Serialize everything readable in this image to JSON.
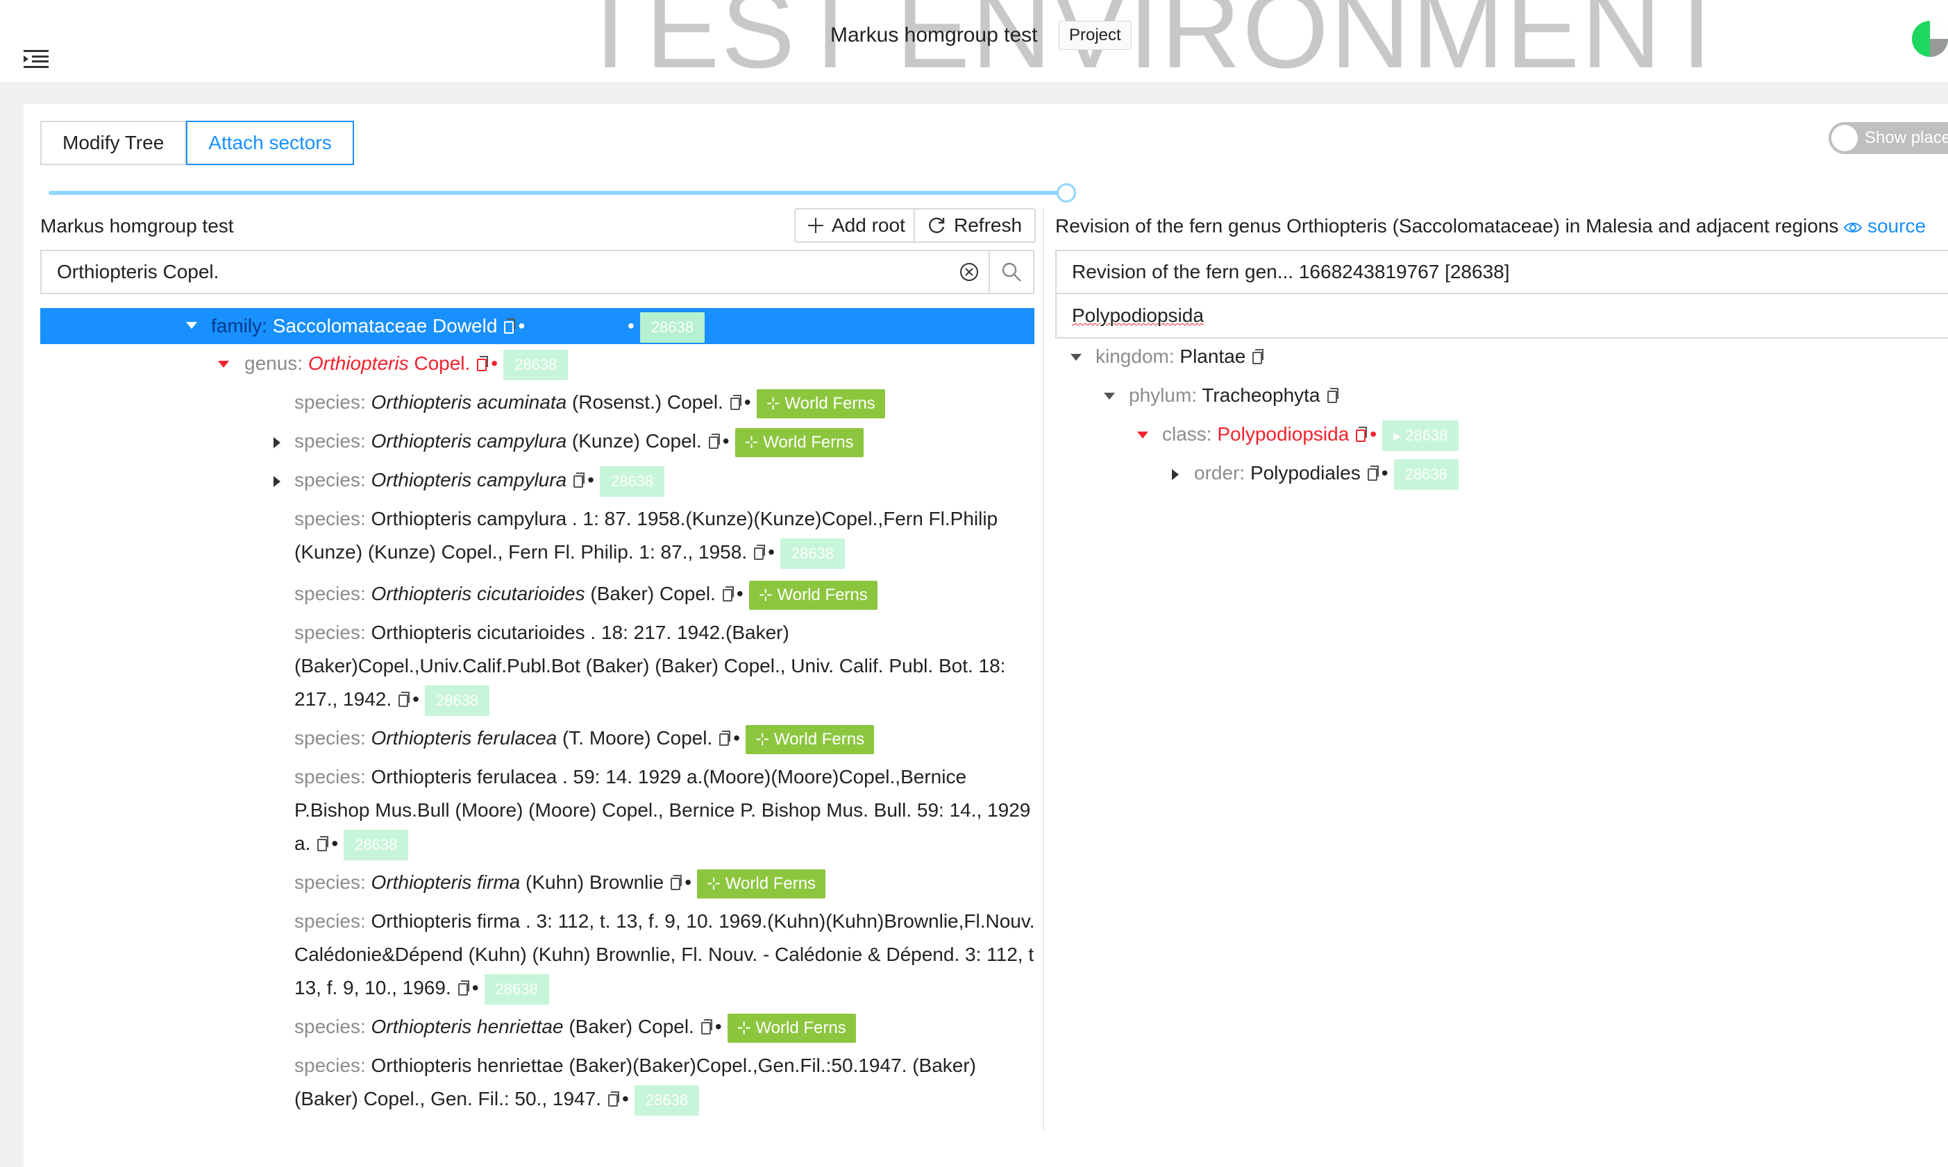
{
  "header": {
    "watermark": "TEST ENVIRONMENT",
    "title": "Markus homgroup test",
    "project_tag": "Project",
    "menu_icon": "menu-fold-icon",
    "avatar_icon": "user-avatar-icon"
  },
  "toolbar": {
    "modify_tree": "Modify Tree",
    "attach_sectors": "Attach sectors",
    "show_placeholders": "Show place"
  },
  "left": {
    "title": "Markus homgroup test",
    "add_root": "Add root",
    "refresh": "Refresh",
    "search_value": "Orthiopteris Copel."
  },
  "tree": {
    "family": {
      "rank": "family:",
      "name": "Saccolomataceae Doweld",
      "dataset": "28638"
    },
    "genus": {
      "rank": "genus:",
      "name_italic": "Orthiopteris",
      "author": " Copel.",
      "dataset": "28638"
    },
    "species": [
      {
        "rank": "species:",
        "italic": "Orthiopteris acuminata",
        "rest": " (Rosenst.) Copel.",
        "tag": "World Ferns"
      },
      {
        "rank": "species:",
        "italic": "Orthiopteris campylura",
        "rest": " (Kunze) Copel.",
        "tag": "World Ferns"
      },
      {
        "rank": "species:",
        "italic": "Orthiopteris campylura",
        "rest": "",
        "tag": "28638"
      },
      {
        "rank": "species:",
        "line1": "Orthiopteris campylura . 1: 87. 1958.(Kunze)(Kunze)Copel.,Fern Fl.Philip",
        "line2": "(Kunze) (Kunze) Copel., Fern Fl. Philip. 1: 87., 1958.",
        "tag": "28638"
      },
      {
        "rank": "species:",
        "italic": "Orthiopteris cicutarioides",
        "rest": " (Baker) Copel.",
        "tag": "World Ferns"
      },
      {
        "rank": "species:",
        "line1": "Orthiopteris cicutarioides . 18: 217. 1942.(Baker)",
        "line2": "(Baker)Copel.,Univ.Calif.Publ.Bot (Baker) (Baker) Copel., Univ. Calif. Publ. Bot. 18:",
        "line3": "217., 1942.",
        "tag": "28638"
      },
      {
        "rank": "species:",
        "italic": "Orthiopteris ferulacea",
        "rest": " (T. Moore) Copel.",
        "tag": "World Ferns"
      },
      {
        "rank": "species:",
        "line1": "Orthiopteris ferulacea . 59: 14. 1929 a.(Moore)(Moore)Copel.,Bernice",
        "line2": "P.Bishop Mus.Bull (Moore) (Moore) Copel., Bernice P. Bishop Mus. Bull. 59: 14., 1929",
        "line3": "a.",
        "tag": "28638"
      },
      {
        "rank": "species:",
        "italic": "Orthiopteris firma",
        "rest": " (Kuhn) Brownlie",
        "tag": "World Ferns"
      },
      {
        "rank": "species:",
        "line1": "Orthiopteris firma . 3: 112, t. 13, f. 9, 10. 1969.(Kuhn)(Kuhn)Brownlie,Fl.Nouv.-",
        "line2": "Calédonie&Dépend (Kuhn) (Kuhn) Brownlie, Fl. Nouv. - Calédonie & Dépend. 3: 112, t.",
        "line3": "13, f. 9, 10., 1969.",
        "tag": "28638"
      },
      {
        "rank": "species:",
        "italic": "Orthiopteris henriettae",
        "rest": " (Baker) Copel.",
        "tag": "World Ferns"
      },
      {
        "rank": "species:",
        "line1": "Orthiopteris henriettae (Baker)(Baker)Copel.,Gen.Fil.:50.1947. (Baker)",
        "line2": "(Baker) Copel., Gen. Fil.: 50., 1947.",
        "tag": "28638"
      }
    ]
  },
  "right": {
    "title": "Revision of the fern genus Orthiopteris (Saccolomataceae) in Malesia and adjacent regions",
    "source_link": "source",
    "dataset_select": "Revision of the fern gen... 1668243819767 [28638]",
    "search_value": "Polypodiopsida",
    "tree": [
      {
        "rank": "kingdom:",
        "name": "Plantae"
      },
      {
        "rank": "phylum:",
        "name": "Tracheophyta"
      },
      {
        "rank": "class:",
        "name": "Polypodiopsida",
        "tag": "28638"
      },
      {
        "rank": "order:",
        "name": "Polypodiales",
        "tag": "28638"
      }
    ]
  },
  "colors": {
    "primary": "#1890ff",
    "world_ferns_tag": "#8cc63f",
    "dataset_tag": "#c7f5d9",
    "highlight_red": "#f5222d"
  }
}
